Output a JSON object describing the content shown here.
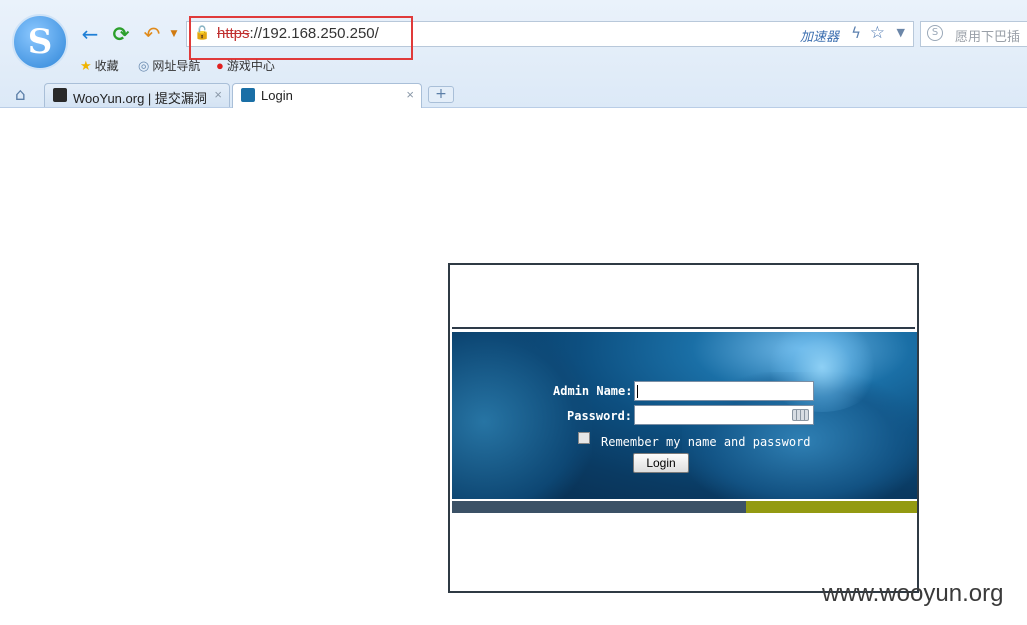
{
  "browser": {
    "logo_letter": "S",
    "nav": {
      "back_icon": "←",
      "refresh_icon": "⟳",
      "undo_icon": "↶"
    },
    "address": {
      "protocol": "https",
      "rest": "://192.168.250.250/"
    },
    "accelerator_label": "加速器",
    "search_placeholder": "愿用下巴插",
    "bookmarks": [
      {
        "icon": "★",
        "label": "收藏"
      },
      {
        "icon": "◎",
        "label": "网址导航"
      },
      {
        "icon": "●",
        "label": "游戏中心"
      }
    ],
    "tabs": [
      {
        "label": "WooYun.org | 提交漏洞",
        "active": false
      },
      {
        "label": "Login",
        "active": true
      }
    ],
    "newtab_icon": "+",
    "close_glyph": "×"
  },
  "login": {
    "admin_name_label": "Admin Name:",
    "password_label": "Password:",
    "remember_label": "Remember my name and password",
    "login_button": "Login",
    "admin_name_value": "",
    "password_value": ""
  },
  "watermark": "www.wooyun.org",
  "colors": {
    "highlight": "#e03a3a",
    "stripe_dark": "#3b5166",
    "stripe_olive": "#939a12"
  }
}
